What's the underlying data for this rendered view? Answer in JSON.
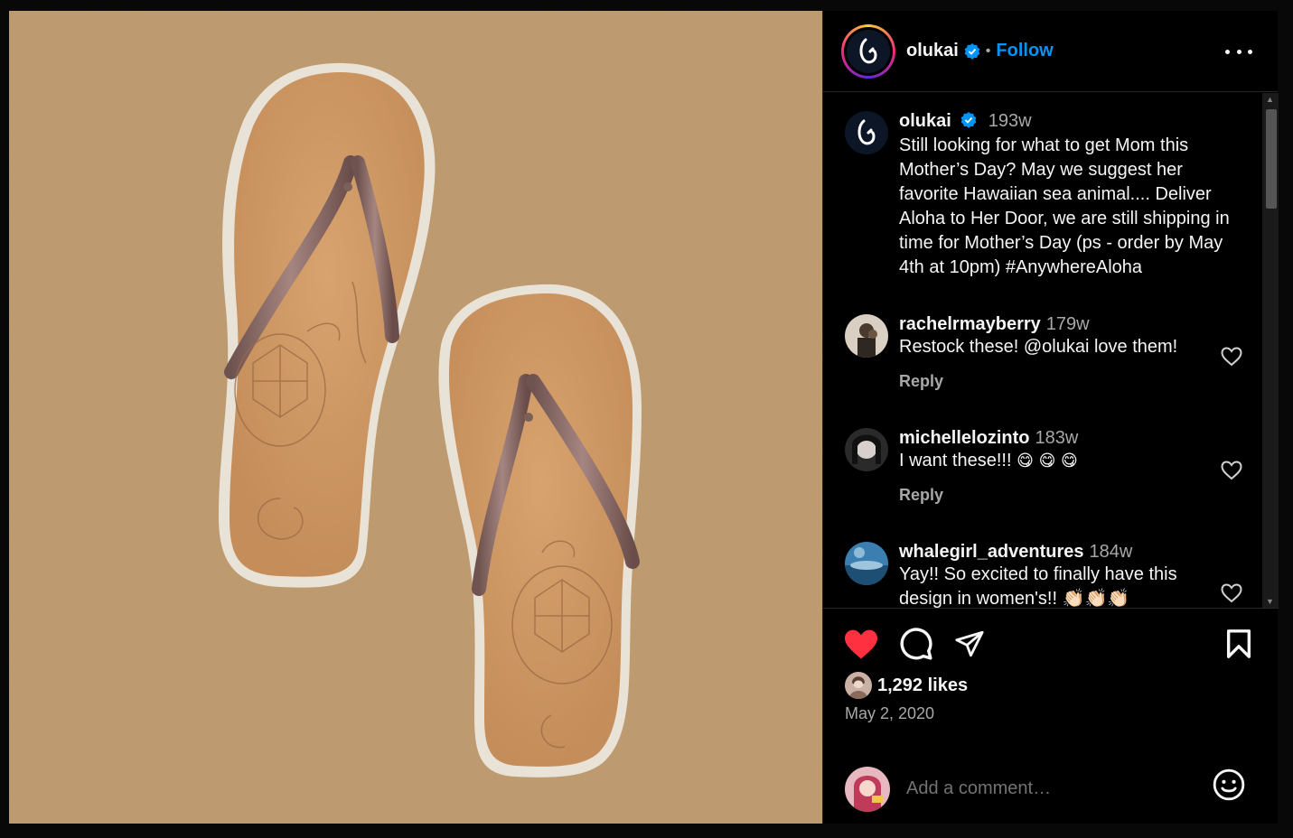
{
  "post": {
    "username": "olukai",
    "separator": "•",
    "follow_label": "Follow",
    "more_icon": "more-horizontal-icon"
  },
  "caption": {
    "username": "olukai",
    "time": "193w",
    "text": "Still looking for what to get Mom this Mother’s Day? May we suggest her favorite Hawaiian sea animal.... Deliver Aloha to Her Door, we are still shipping in time for Mother’s Day (ps - order by May 4th at 10pm) #AnywhereAloha"
  },
  "comments": [
    {
      "username": "rachelrmayberry",
      "time": "179w",
      "text": "Restock these! @olukai love them!",
      "reply_label": "Reply"
    },
    {
      "username": "michellelozinto",
      "time": "183w",
      "text": "I want these!!! ",
      "emojis": "😋 😋 😋",
      "reply_label": "Reply"
    },
    {
      "username": "whalegirl_adventures",
      "time": "184w",
      "text": "Yay!! So excited to finally have this design in women's!! 👏🏻👏🏻👏🏻"
    }
  ],
  "actions": {
    "likes": "1,292 likes",
    "date": "May 2, 2020",
    "comment_placeholder": "Add a comment…"
  },
  "colors": {
    "accent": "#0095f6",
    "like": "#ff3040",
    "background": "#000000",
    "sand": "#c19a6b"
  }
}
